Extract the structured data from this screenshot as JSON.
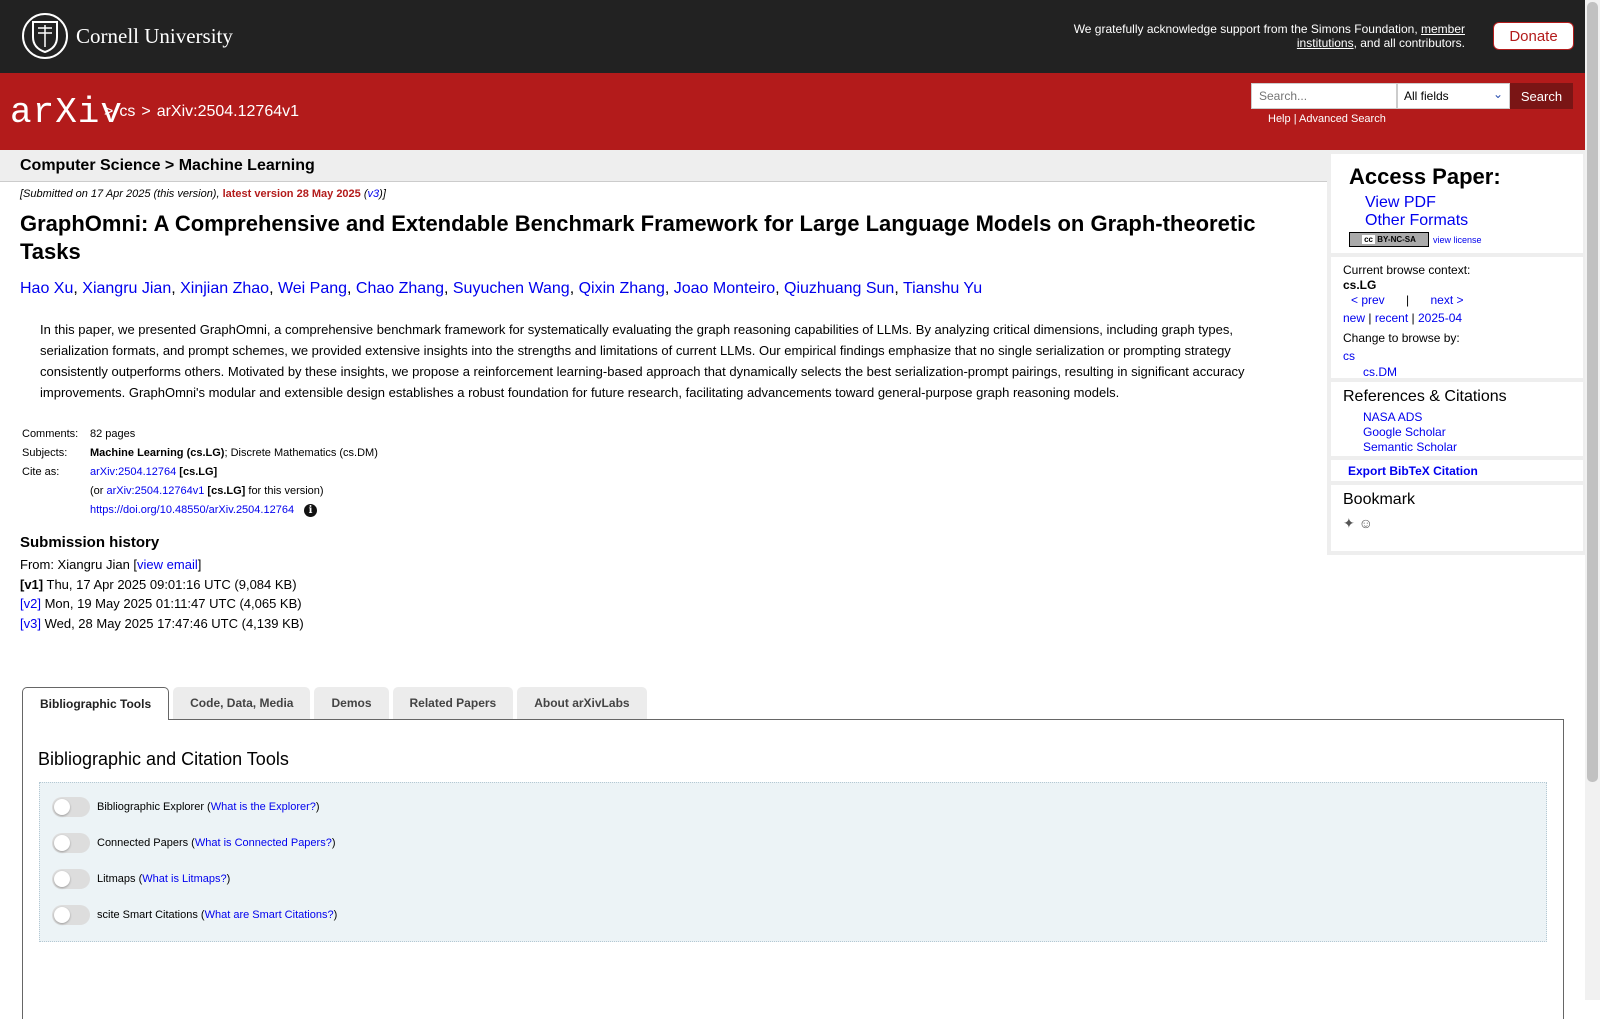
{
  "topbar": {
    "university": "Cornell University",
    "ack_prefix": "We gratefully acknowledge support from the Simons Foundation, ",
    "ack_link": "member institutions",
    "ack_suffix": ", and all contributors.",
    "donate": "Donate"
  },
  "header": {
    "logo": "arXiv",
    "crumbs": [
      ">",
      "cs",
      ">",
      "arXiv:2504.12764v1"
    ],
    "search_placeholder": "Search...",
    "search_field": "All fields",
    "search_button": "Search",
    "help": "Help",
    "sep": "|",
    "advanced": "Advanced Search"
  },
  "subheader": {
    "crumb": "Computer Science > Machine Learning"
  },
  "paper": {
    "dateline_prefix": "[Submitted on 17 Apr 2025 (this version), ",
    "dateline_latest": "latest version 28 May 2025",
    "dateline_open": " (",
    "dateline_v3": "v3",
    "dateline_close": ")]",
    "title": "GraphOmni: A Comprehensive and Extendable Benchmark Framework for Large Language Models on Graph-theoretic Tasks",
    "authors": [
      "Hao Xu",
      "Xiangru Jian",
      "Xinjian Zhao",
      "Wei Pang",
      "Chao Zhang",
      "Suyuchen Wang",
      "Qixin Zhang",
      "Joao Monteiro",
      "Qiuzhuang Sun",
      "Tianshu Yu"
    ],
    "abstract": "In this paper, we presented GraphOmni, a comprehensive benchmark framework for systematically evaluating the graph reasoning capabilities of LLMs. By analyzing critical dimensions, including graph types, serialization formats, and prompt schemes, we provided extensive insights into the strengths and limitations of current LLMs. Our empirical findings emphasize that no single serialization or prompting strategy consistently outperforms others. Motivated by these insights, we propose a reinforcement learning-based approach that dynamically selects the best serialization-prompt pairings, resulting in significant accuracy improvements. GraphOmni's modular and extensible design establishes a robust foundation for future research, facilitating advancements toward general-purpose graph reasoning models."
  },
  "meta": {
    "comments_label": "Comments:",
    "comments": "82 pages",
    "subjects_label": "Subjects:",
    "subject_primary": "Machine Learning (cs.LG)",
    "subject_rest": "; Discrete Mathematics (cs.DM)",
    "cite_label": "Cite as:",
    "cite_link": "arXiv:2504.12764",
    "cite_tag": "[cs.LG]",
    "cite2_prefix": "(or ",
    "cite2_link": "arXiv:2504.12764v1",
    "cite2_tag": "[cs.LG]",
    "cite2_suffix": " for this version)",
    "doi": "https://doi.org/10.48550/arXiv.2504.12764",
    "info_glyph": "i"
  },
  "history": {
    "title": "Submission history",
    "from_prefix": "From: Xiangru Jian [",
    "view_email": "view email",
    "from_suffix": "]",
    "versions": [
      {
        "label": "[v1]",
        "text": " Thu, 17 Apr 2025 09:01:16 UTC (9,084 KB)"
      },
      {
        "label": "[v2]",
        "text": " Mon, 19 May 2025 01:11:47 UTC (4,065 KB)"
      },
      {
        "label": "[v3]",
        "text": " Wed, 28 May 2025 17:47:46 UTC (4,139 KB)"
      }
    ]
  },
  "sidebar": {
    "access_title": "Access Paper:",
    "view_pdf": "View PDF",
    "other_formats": "Other Formats",
    "cc_badge": "BY-NC-SA",
    "view_license": "view license",
    "context_label": "Current browse context:",
    "context": "cs.LG",
    "prev": "< prev",
    "pipe": "|",
    "next": "next >",
    "new": "new",
    "recent": "recent",
    "month": "2025-04",
    "change_label": "Change to browse by:",
    "browse1": "cs",
    "browse2": "cs.DM",
    "refs_title": "References & Citations",
    "refs": [
      "NASA ADS",
      "Google Scholar",
      "Semantic Scholar"
    ],
    "bibtex": "Export BibTeX Citation",
    "bookmark_title": "Bookmark"
  },
  "tabs": [
    "Bibliographic Tools",
    "Code, Data, Media",
    "Demos",
    "Related Papers",
    "About arXivLabs"
  ],
  "tools": {
    "title": "Bibliographic and Citation Tools",
    "rows": [
      {
        "name": "Bibliographic Explorer",
        "link": "What is the Explorer?"
      },
      {
        "name": "Connected Papers",
        "link": "What is Connected Papers?"
      },
      {
        "name": "Litmaps",
        "link": "What is Litmaps?"
      },
      {
        "name": "scite Smart Citations",
        "link": "What are Smart Citations?"
      }
    ]
  }
}
